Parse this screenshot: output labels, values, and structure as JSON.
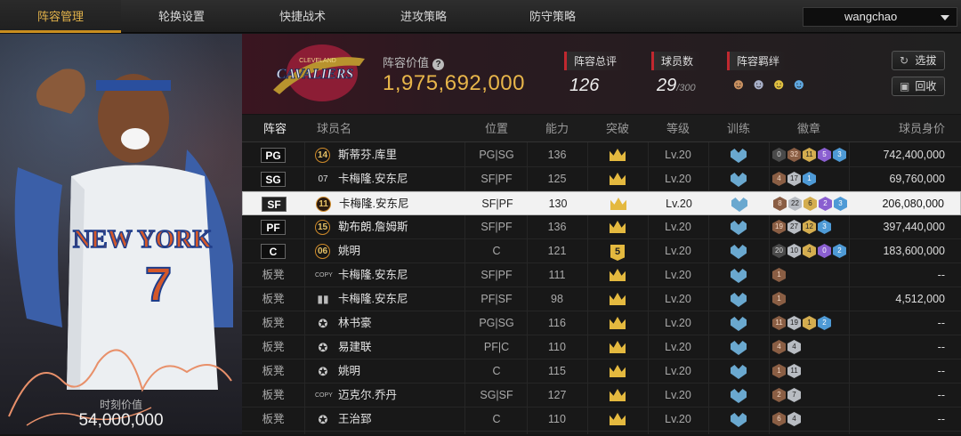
{
  "tabs": [
    "阵容管理",
    "轮换设置",
    "快捷战术",
    "进攻策略",
    "防守策略"
  ],
  "user": {
    "name": "wangchao"
  },
  "player_card": {
    "value_label": "时刻价值",
    "value": "54,000,000",
    "jersey_team": "NEW YORK",
    "jersey_number": "7"
  },
  "lineup_value": {
    "label": "阵容价值",
    "value": "1,975,692,000",
    "help_icon": "question-circle-icon"
  },
  "team_logo": {
    "text": "CAVALIERS",
    "city": "CLEVELAND"
  },
  "stats": {
    "rating": {
      "label": "阵容总评",
      "value": "126"
    },
    "players": {
      "label": "球员数",
      "value": "29",
      "max": "/300"
    },
    "bond": {
      "label": "阵容羁绊"
    }
  },
  "buttons": {
    "pick": "选拔",
    "recycle": "回收"
  },
  "columns": [
    "阵容",
    "球员名",
    "位置",
    "能力",
    "突破",
    "等级",
    "训练",
    "徽章",
    "球员身价"
  ],
  "rows": [
    {
      "slot": "PG",
      "slot_type": "starter",
      "badge": "14",
      "badge_type": "num",
      "name": "斯蒂芬.库里",
      "pos": "PG|SG",
      "ability": "136",
      "break": "crown",
      "level": "Lv.20",
      "badges": [
        [
          "0",
          "dk"
        ],
        [
          "32",
          "br"
        ],
        [
          "11",
          "gd"
        ],
        [
          "5",
          "pu"
        ],
        [
          "3",
          "bl"
        ]
      ],
      "value": "742,400,000"
    },
    {
      "slot": "SG",
      "slot_type": "starter",
      "badge": "07",
      "badge_type": "plain",
      "name": "卡梅隆.安东尼",
      "pos": "SF|PF",
      "ability": "125",
      "break": "crown",
      "level": "Lv.20",
      "badges": [
        [
          "4",
          "br"
        ],
        [
          "17",
          "sv"
        ],
        [
          "1",
          "bl"
        ]
      ],
      "value": "69,760,000"
    },
    {
      "slot": "SF",
      "slot_type": "starter",
      "badge": "11",
      "badge_type": "num",
      "name": "卡梅隆.安东尼",
      "pos": "SF|PF",
      "ability": "130",
      "break": "crown",
      "level": "Lv.20",
      "badges": [
        [
          "8",
          "br"
        ],
        [
          "22",
          "sv"
        ],
        [
          "6",
          "gd"
        ],
        [
          "2",
          "pu"
        ],
        [
          "3",
          "bl"
        ]
      ],
      "value": "206,080,000",
      "selected": true
    },
    {
      "slot": "PF",
      "slot_type": "starter",
      "badge": "15",
      "badge_type": "num",
      "name": "勒布朗.詹姆斯",
      "pos": "SF|PF",
      "ability": "136",
      "break": "crown",
      "level": "Lv.20",
      "badges": [
        [
          "19",
          "br"
        ],
        [
          "27",
          "sv"
        ],
        [
          "12",
          "gd"
        ],
        [
          "3",
          "bl"
        ]
      ],
      "value": "397,440,000"
    },
    {
      "slot": "C",
      "slot_type": "starter",
      "badge": "06",
      "badge_type": "num",
      "name": "姚明",
      "pos": "C",
      "ability": "121",
      "break": "5",
      "level": "Lv.20",
      "badges": [
        [
          "20",
          "dk"
        ],
        [
          "10",
          "sv"
        ],
        [
          "4",
          "gd"
        ],
        [
          "0",
          "pu"
        ],
        [
          "2",
          "bl"
        ]
      ],
      "value": "183,600,000"
    },
    {
      "slot": "板凳",
      "slot_type": "bench",
      "badge": "COPY",
      "badge_type": "copy",
      "name": "卡梅隆.安东尼",
      "pos": "SF|PF",
      "ability": "111",
      "break": "crown",
      "level": "Lv.20",
      "badges": [
        [
          "1",
          "br"
        ]
      ],
      "value": "--"
    },
    {
      "slot": "板凳",
      "slot_type": "bench",
      "badge": "bars",
      "badge_type": "bars",
      "name": "卡梅隆.安东尼",
      "pos": "PF|SF",
      "ability": "98",
      "break": "crown",
      "level": "Lv.20",
      "badges": [
        [
          "1",
          "br"
        ]
      ],
      "value": "4,512,000"
    },
    {
      "slot": "板凳",
      "slot_type": "bench",
      "badge": "star",
      "badge_type": "star",
      "name": "林书豪",
      "pos": "PG|SG",
      "ability": "116",
      "break": "crown",
      "level": "Lv.20",
      "badges": [
        [
          "11",
          "br"
        ],
        [
          "19",
          "sv"
        ],
        [
          "1",
          "gd"
        ],
        [
          "2",
          "bl"
        ]
      ],
      "value": "--"
    },
    {
      "slot": "板凳",
      "slot_type": "bench",
      "badge": "star",
      "badge_type": "star",
      "name": "易建联",
      "pos": "PF|C",
      "ability": "110",
      "break": "crown",
      "level": "Lv.20",
      "badges": [
        [
          "4",
          "br"
        ],
        [
          "4",
          "sv"
        ]
      ],
      "value": "--"
    },
    {
      "slot": "板凳",
      "slot_type": "bench",
      "badge": "star",
      "badge_type": "star",
      "name": "姚明",
      "pos": "C",
      "ability": "115",
      "break": "crown",
      "level": "Lv.20",
      "badges": [
        [
          "1",
          "br"
        ],
        [
          "11",
          "sv"
        ]
      ],
      "value": "--"
    },
    {
      "slot": "板凳",
      "slot_type": "bench",
      "badge": "COPY",
      "badge_type": "copy",
      "name": "迈克尔.乔丹",
      "pos": "SG|SF",
      "ability": "127",
      "break": "crown",
      "level": "Lv.20",
      "badges": [
        [
          "2",
          "br"
        ],
        [
          "7",
          "sv"
        ]
      ],
      "value": "--"
    },
    {
      "slot": "板凳",
      "slot_type": "bench",
      "badge": "star",
      "badge_type": "star",
      "name": "王治郅",
      "pos": "C",
      "ability": "110",
      "break": "crown",
      "level": "Lv.20",
      "badges": [
        [
          "6",
          "br"
        ],
        [
          "4",
          "sv"
        ]
      ],
      "value": "--"
    }
  ]
}
